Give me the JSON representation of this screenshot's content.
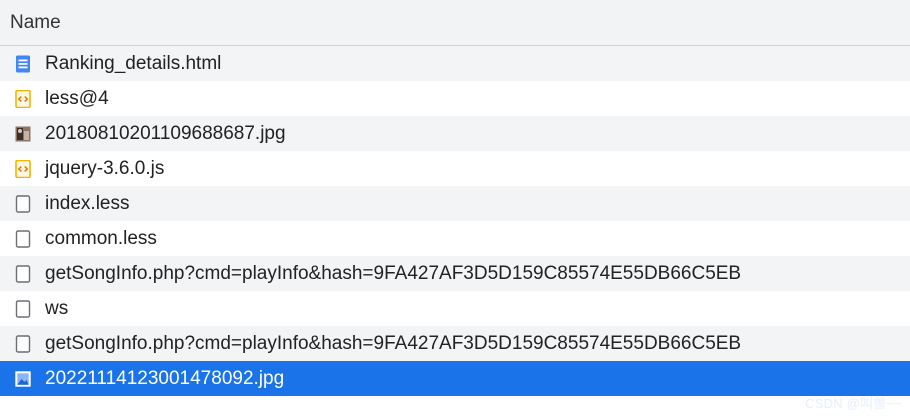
{
  "header": {
    "name_label": "Name"
  },
  "requests": [
    {
      "name": "Ranking_details.html",
      "icon": "document-icon",
      "selected": false
    },
    {
      "name": "less@4",
      "icon": "script-icon",
      "selected": false
    },
    {
      "name": "20180810201109688687.jpg",
      "icon": "image-thumbnail-icon",
      "selected": false
    },
    {
      "name": "jquery-3.6.0.js",
      "icon": "script-icon",
      "selected": false
    },
    {
      "name": "index.less",
      "icon": "blank-file-icon",
      "selected": false
    },
    {
      "name": "common.less",
      "icon": "blank-file-icon",
      "selected": false
    },
    {
      "name": "getSongInfo.php?cmd=playInfo&hash=9FA427AF3D5D159C85574E55DB66C5EB",
      "icon": "blank-file-icon",
      "selected": false
    },
    {
      "name": "ws",
      "icon": "blank-file-icon",
      "selected": false
    },
    {
      "name": "getSongInfo.php?cmd=playInfo&hash=9FA427AF3D5D159C85574E55DB66C5EB",
      "icon": "blank-file-icon",
      "selected": false
    },
    {
      "name": "20221114123001478092.jpg",
      "icon": "image-icon",
      "selected": true
    }
  ],
  "watermark": "CSDN @叫兽~~",
  "colors": {
    "selected_row": "#1a73e8",
    "striped_row": "#f3f4f5",
    "document_icon": "#4285f4",
    "script_icon": "#f4b400"
  }
}
